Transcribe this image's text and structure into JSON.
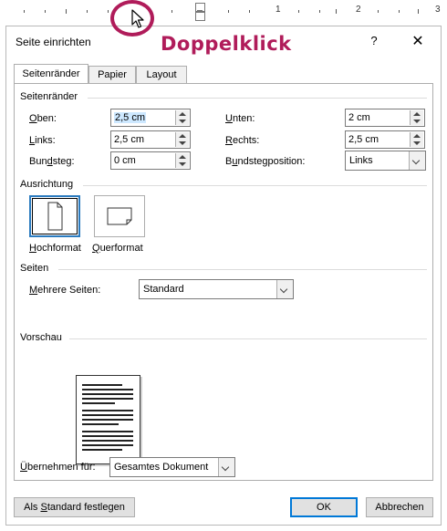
{
  "ruler": {
    "numbers": [
      "1",
      "2",
      "3"
    ]
  },
  "callout": {
    "text": "Doppelklick"
  },
  "dialog": {
    "title": "Seite einrichten",
    "help": "?",
    "close": "✕",
    "tabs": [
      {
        "label": "Seitenränder",
        "active": true
      },
      {
        "label": "Papier",
        "active": false
      },
      {
        "label": "Layout",
        "active": false
      }
    ]
  },
  "margins": {
    "group_label": "Seitenränder",
    "oben": {
      "label_u": "O",
      "label_rest": "ben:",
      "value": "2,5 cm"
    },
    "links": {
      "label_u": "L",
      "label_rest": "inks:",
      "value": "2,5 cm"
    },
    "bundsteg": {
      "label_pre": "Bun",
      "label_u": "d",
      "label_rest": "steg:",
      "value": "0 cm"
    },
    "unten": {
      "label_u": "U",
      "label_rest": "nten:",
      "value": "2 cm"
    },
    "rechts": {
      "label_u": "R",
      "label_rest": "echts:",
      "value": "2,5 cm"
    },
    "bundstegposition": {
      "label_pre": "B",
      "label_u": "u",
      "label_rest": "ndstegposition:",
      "value": "Links"
    }
  },
  "orientation": {
    "group_label": "Ausrichtung",
    "hochformat": {
      "label_u": "H",
      "label_rest": "ochformat",
      "selected": true
    },
    "querformat": {
      "label_u": "Q",
      "label_rest": "uerformat",
      "selected": false
    }
  },
  "pages": {
    "group_label": "Seiten",
    "mehrere": {
      "label_u": "M",
      "label_rest": "ehrere Seiten:",
      "value": "Standard"
    }
  },
  "preview": {
    "group_label": "Vorschau"
  },
  "apply": {
    "label_u": "Ü",
    "label_rest": "bernehmen für:",
    "value": "Gesamtes Dokument"
  },
  "buttons": {
    "standard_pre": "Als ",
    "standard_u": "S",
    "standard_rest": "tandard festlegen",
    "ok": "OK",
    "abbrechen": "Abbrechen"
  }
}
